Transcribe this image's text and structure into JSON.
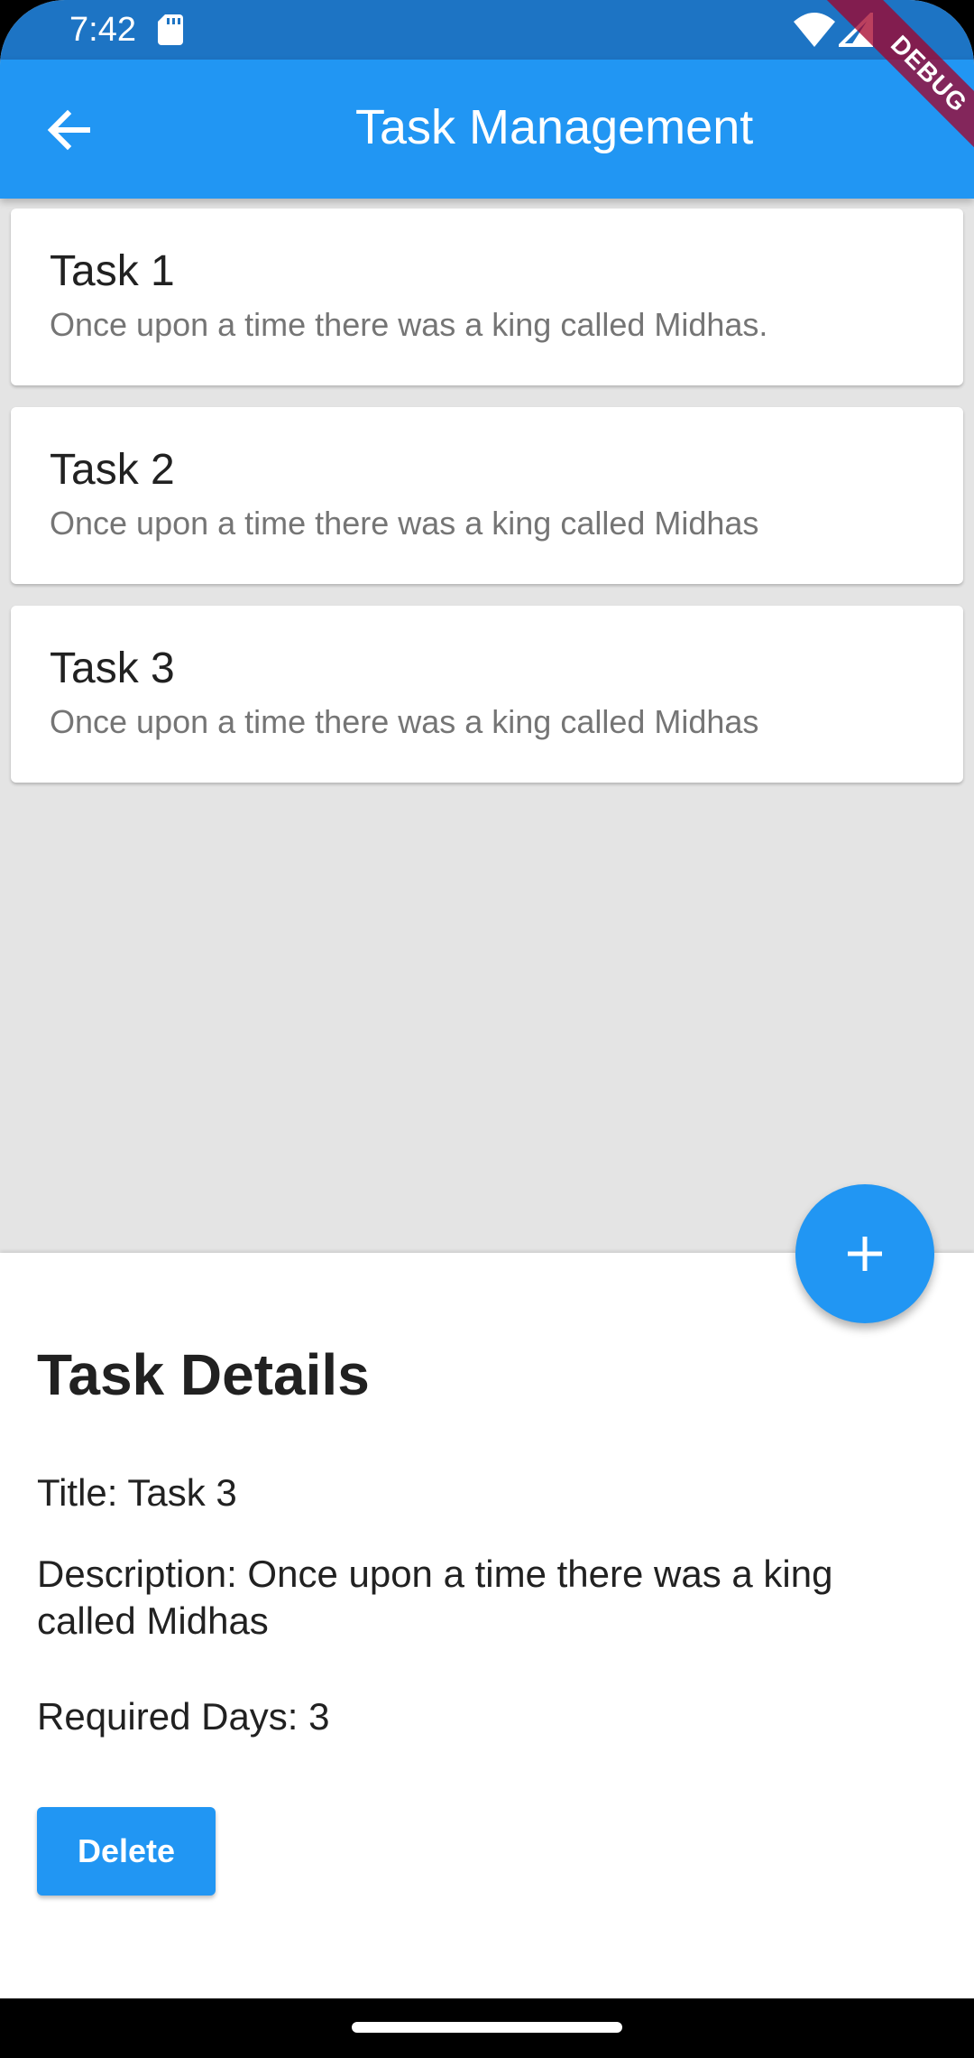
{
  "status_bar": {
    "time": "7:42",
    "icons": [
      "sd-card-icon",
      "wifi-icon",
      "signal-icon"
    ]
  },
  "debug_banner": "DEBUG",
  "app_bar": {
    "title": "Task Management",
    "back_icon": "arrow-back-icon"
  },
  "tasks": [
    {
      "title": "Task 1",
      "description": "Once upon a time there was a king called Midhas."
    },
    {
      "title": "Task 2",
      "description": "Once upon a time there was a king called Midhas"
    },
    {
      "title": "Task 3",
      "description": "Once upon a time there was a king called Midhas"
    }
  ],
  "fab": {
    "icon": "add-icon",
    "symbol": "+"
  },
  "details_sheet": {
    "heading": "Task Details",
    "title_line": "Title: Task 3",
    "description_line": "Description: Once upon a time there was a king called Midhas",
    "required_days_line": "Required Days: 3",
    "delete_label": "Delete"
  },
  "colors": {
    "primary": "#2196f3",
    "status_bar": "#1d74c4",
    "background": "#e4e4e4",
    "card": "#ffffff",
    "debug_banner": "#a40028"
  }
}
